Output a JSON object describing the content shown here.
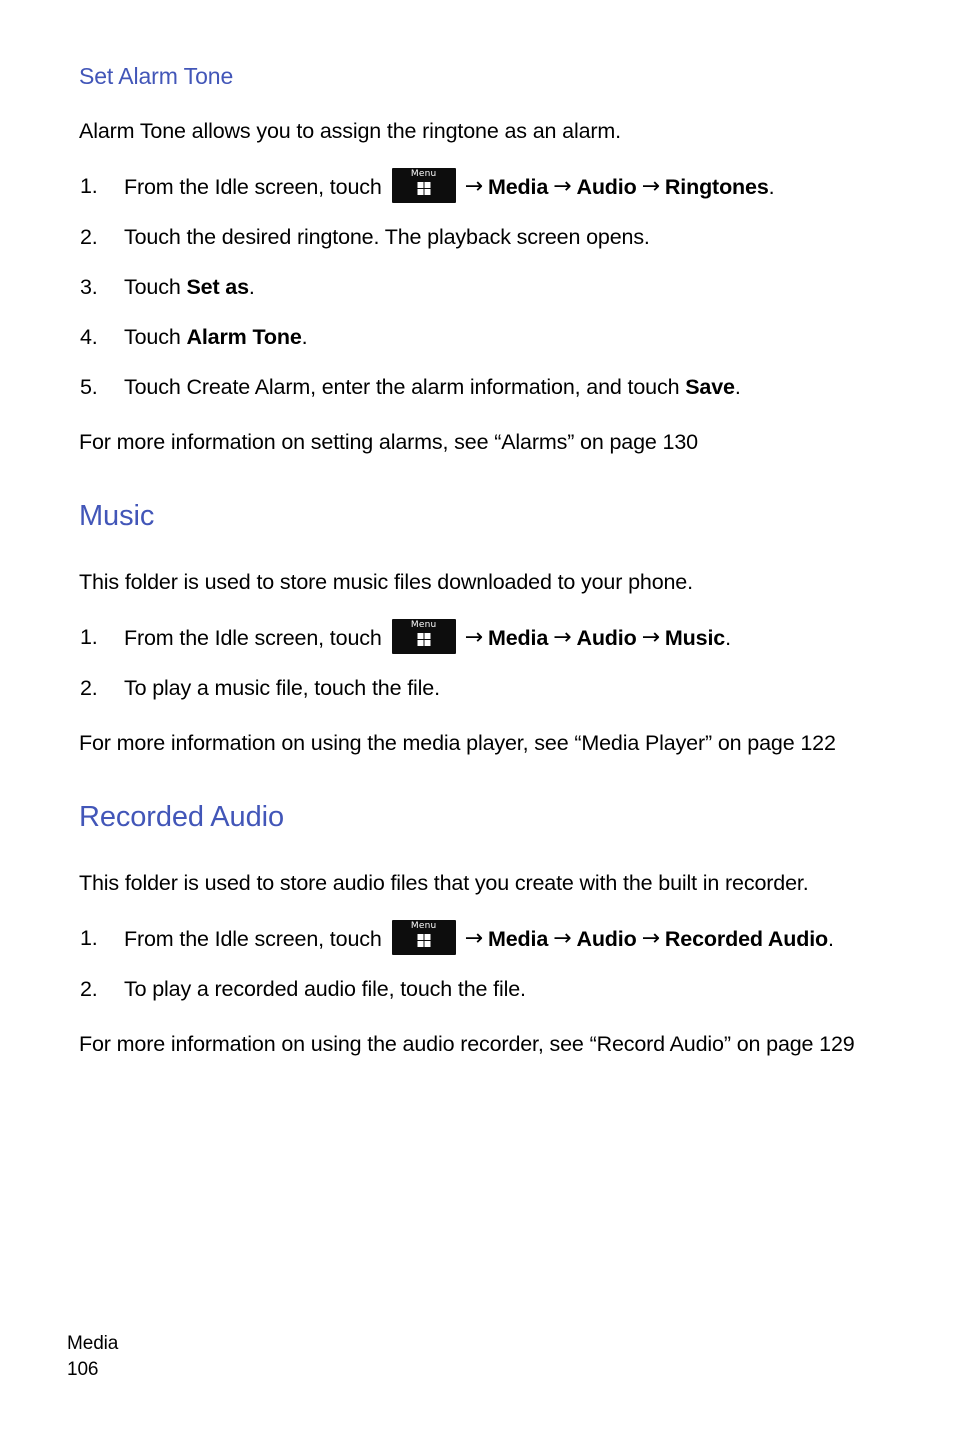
{
  "page": {
    "footer_section": "Media",
    "footer_page_number": "106"
  },
  "icons": {
    "menu_key_label": "Menu",
    "arrow": "→"
  },
  "sections": {
    "set_alarm_tone": {
      "heading": "Set Alarm Tone",
      "intro": "Alarm Tone allows you to assign the ringtone as an alarm.",
      "steps": {
        "s1": {
          "num": "1.",
          "prefix": "From the Idle screen, touch",
          "nav1": "Media",
          "nav2": "Audio",
          "nav3": "Ringtones",
          "suffix": "."
        },
        "s2": {
          "num": "2.",
          "text": "Touch the desired ringtone. The playback screen opens."
        },
        "s3": {
          "num": "3.",
          "pre": "Touch ",
          "bold": "Set as",
          "post": "."
        },
        "s4": {
          "num": "4.",
          "pre": "Touch ",
          "bold": "Alarm Tone",
          "post": "."
        },
        "s5": {
          "num": "5.",
          "pre": "Touch Create Alarm, enter the alarm information, and touch ",
          "bold": "Save",
          "post": "."
        }
      },
      "more_info": "For more information on setting alarms, see “Alarms” on page 130"
    },
    "music": {
      "heading": "Music",
      "intro": "This folder is used to store music files downloaded to your phone.",
      "steps": {
        "s1": {
          "num": "1.",
          "prefix": "From the Idle screen, touch",
          "nav1": "Media",
          "nav2": "Audio",
          "nav3": "Music",
          "suffix": "."
        },
        "s2": {
          "num": "2.",
          "text": "To play a music file, touch the file."
        }
      },
      "more_info": "For more information on using the media player, see “Media Player” on page 122"
    },
    "recorded_audio": {
      "heading": "Recorded Audio",
      "intro": "This folder is used to store audio files that you create with the built in recorder.",
      "steps": {
        "s1": {
          "num": "1.",
          "prefix": "From the Idle screen, touch",
          "nav1": "Media",
          "nav2": "Audio",
          "nav3": "Recorded Audio",
          "suffix": "."
        },
        "s2": {
          "num": "2.",
          "text": "To play a recorded audio file, touch the file."
        }
      },
      "more_info": "For more information on using the audio recorder, see “Record Audio” on page 129"
    }
  },
  "colors": {
    "heading_blue": "#4256b8",
    "body_black": "#000000",
    "menu_key_bg": "#0d0d0d"
  }
}
